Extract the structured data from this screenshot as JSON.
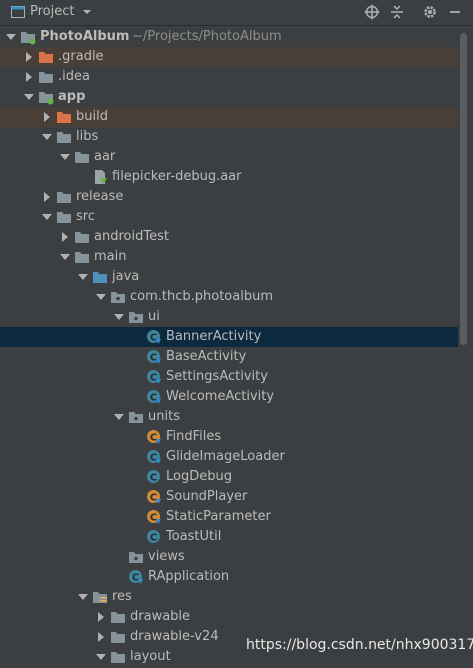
{
  "toolbar": {
    "title": "Project",
    "icons": [
      "project-window-icon",
      "dropdown-icon",
      "locate-icon",
      "collapse-all-icon",
      "settings-icon",
      "hide-icon"
    ]
  },
  "root": {
    "name": "PhotoAlbum",
    "path": "~/Projects/PhotoAlbum"
  },
  "tree": [
    {
      "label": "PhotoAlbum",
      "path": "~/Projects/PhotoAlbum",
      "depth": 0,
      "arrow": "down",
      "icon": "module-folder",
      "bold": true,
      "name": "tree-node-photoalbum"
    },
    {
      "label": ".gradle",
      "depth": 1,
      "arrow": "right",
      "icon": "folder-excluded",
      "highlight": "excluded",
      "name": "tree-node-gradle"
    },
    {
      "label": ".idea",
      "depth": 1,
      "arrow": "right",
      "icon": "folder",
      "name": "tree-node-idea"
    },
    {
      "label": "app",
      "depth": 1,
      "arrow": "down",
      "icon": "module-folder",
      "bold": true,
      "name": "tree-node-app"
    },
    {
      "label": "build",
      "depth": 2,
      "arrow": "right",
      "icon": "folder-excluded",
      "highlight": "excluded",
      "name": "tree-node-build"
    },
    {
      "label": "libs",
      "depth": 2,
      "arrow": "down",
      "icon": "folder",
      "name": "tree-node-libs"
    },
    {
      "label": "aar",
      "depth": 3,
      "arrow": "down",
      "icon": "folder",
      "name": "tree-node-aar"
    },
    {
      "label": "filepicker-debug.aar",
      "depth": 4,
      "arrow": "none",
      "icon": "aar-file",
      "name": "tree-node-filepicker-aar"
    },
    {
      "label": "release",
      "depth": 2,
      "arrow": "right",
      "icon": "folder",
      "name": "tree-node-release"
    },
    {
      "label": "src",
      "depth": 2,
      "arrow": "down",
      "icon": "folder",
      "name": "tree-node-src"
    },
    {
      "label": "androidTest",
      "depth": 3,
      "arrow": "right",
      "icon": "folder",
      "name": "tree-node-androidtest"
    },
    {
      "label": "main",
      "depth": 3,
      "arrow": "down",
      "icon": "folder",
      "name": "tree-node-main"
    },
    {
      "label": "java",
      "depth": 4,
      "arrow": "down",
      "icon": "source-folder",
      "name": "tree-node-java"
    },
    {
      "label": "com.thcb.photoalbum",
      "depth": 5,
      "arrow": "down",
      "icon": "package",
      "name": "tree-node-package"
    },
    {
      "label": "ui",
      "depth": 6,
      "arrow": "down",
      "icon": "package",
      "name": "tree-node-ui"
    },
    {
      "label": "BannerActivity",
      "depth": 7,
      "arrow": "none",
      "icon": "class",
      "highlight": "selected",
      "name": "tree-node-banneractivity"
    },
    {
      "label": "BaseActivity",
      "depth": 7,
      "arrow": "none",
      "icon": "class",
      "name": "tree-node-baseactivity"
    },
    {
      "label": "SettingsActivity",
      "depth": 7,
      "arrow": "none",
      "icon": "class",
      "name": "tree-node-settingsactivity"
    },
    {
      "label": "WelcomeActivity",
      "depth": 7,
      "arrow": "none",
      "icon": "class",
      "name": "tree-node-welcomeactivity"
    },
    {
      "label": "units",
      "depth": 6,
      "arrow": "down",
      "icon": "package",
      "name": "tree-node-units"
    },
    {
      "label": "FindFiles",
      "depth": 7,
      "arrow": "none",
      "icon": "class-orange",
      "name": "tree-node-findfiles"
    },
    {
      "label": "GlideImageLoader",
      "depth": 7,
      "arrow": "none",
      "icon": "class",
      "name": "tree-node-glideimageloader"
    },
    {
      "label": "LogDebug",
      "depth": 7,
      "arrow": "none",
      "icon": "class-plain",
      "name": "tree-node-logdebug"
    },
    {
      "label": "SoundPlayer",
      "depth": 7,
      "arrow": "none",
      "icon": "class-orange",
      "name": "tree-node-soundplayer"
    },
    {
      "label": "StaticParameter",
      "depth": 7,
      "arrow": "none",
      "icon": "class-orange",
      "name": "tree-node-staticparameter"
    },
    {
      "label": "ToastUtil",
      "depth": 7,
      "arrow": "none",
      "icon": "class-plain",
      "name": "tree-node-toastutil"
    },
    {
      "label": "views",
      "depth": 6,
      "arrow": "none",
      "icon": "package",
      "name": "tree-node-views"
    },
    {
      "label": "RApplication",
      "depth": 6,
      "arrow": "none",
      "icon": "class",
      "name": "tree-node-rapplication"
    },
    {
      "label": "res",
      "depth": 4,
      "arrow": "down",
      "icon": "resource-folder",
      "name": "tree-node-res"
    },
    {
      "label": "drawable",
      "depth": 5,
      "arrow": "right",
      "icon": "folder",
      "name": "tree-node-drawable"
    },
    {
      "label": "drawable-v24",
      "depth": 5,
      "arrow": "right",
      "icon": "folder",
      "name": "tree-node-drawable-v24"
    },
    {
      "label": "layout",
      "depth": 5,
      "arrow": "down",
      "icon": "folder",
      "name": "tree-node-layout"
    }
  ],
  "watermark": "https://blog.csdn.net/nhx900317",
  "colors": {
    "background": "#3c3f41",
    "selected_row": "#0d293e",
    "excluded_row": "#4a3f36",
    "folder": "#87939a",
    "folder_excluded": "#d9734a",
    "source_folder": "#4d90b8",
    "class_blue": "#3e86a0",
    "class_orange": "#d08a3a",
    "module_dot": "#62b543"
  }
}
